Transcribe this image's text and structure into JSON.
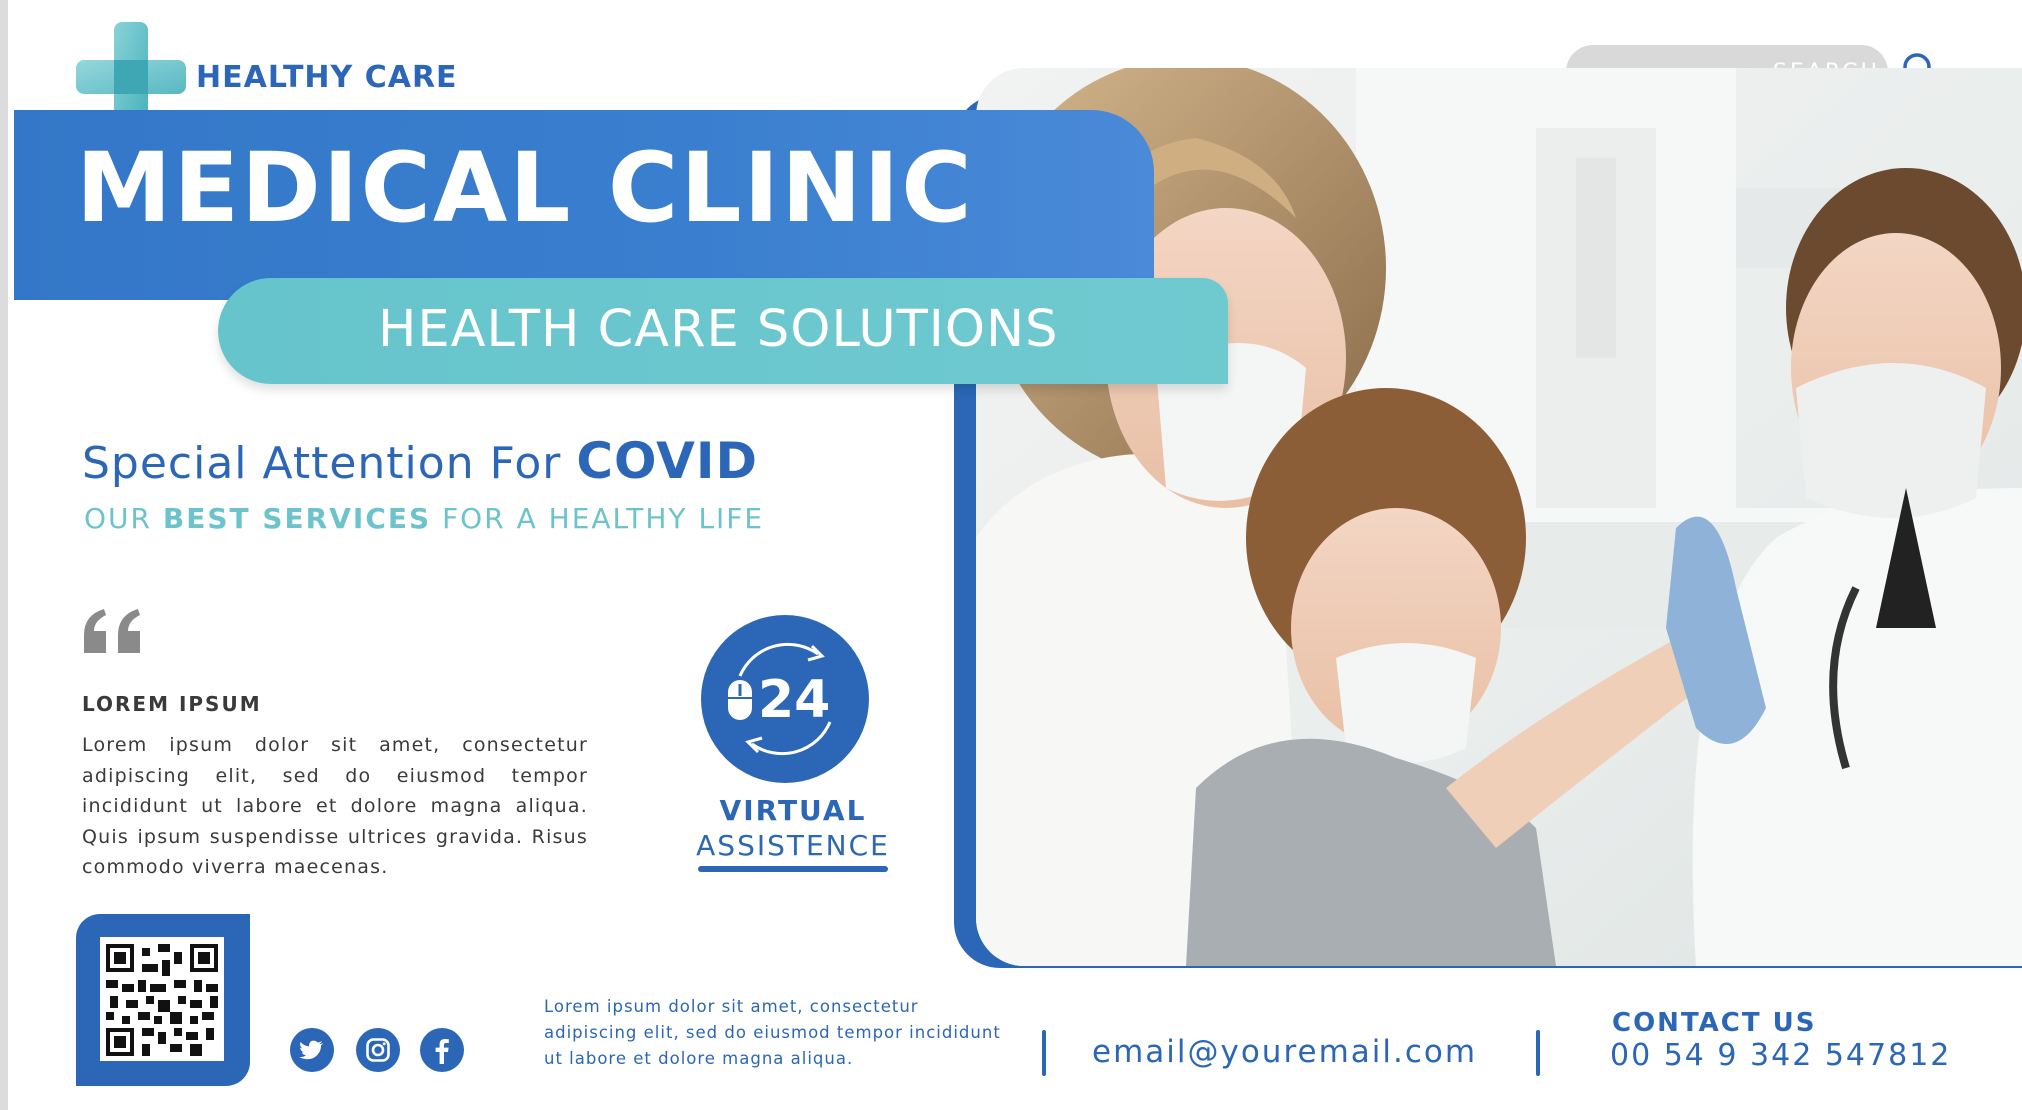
{
  "brand": {
    "name": "HEALTHY CARE",
    "logo_icon": "medical-cross-icon"
  },
  "search": {
    "label": "SEARCH",
    "icon": "search-icon"
  },
  "hero": {
    "title": "MEDICAL CLINIC",
    "subtitle": "HEALTH CARE SOLUTIONS"
  },
  "headline": {
    "prefix": "Special Attention For",
    "emphasis": "COVID",
    "services_prefix": "OUR",
    "services_emphasis": "BEST SERVICES",
    "services_suffix": "FOR A HEALTHY LIFE"
  },
  "quote": {
    "icon": "quote-icon",
    "heading": "LOREM IPSUM",
    "body": "Lorem ipsum dolor sit amet, consectetur adipiscing elit, sed do eiusmod tempor incididunt ut labore et dolore magna aliqua. Quis ipsum suspendisse ultrices gravida. Risus commodo viverra maecenas."
  },
  "badge": {
    "number": "24",
    "line1": "VIRTUAL",
    "line2": "ASSISTENCE",
    "icon": "mouse-cycle-icon"
  },
  "footer": {
    "qr_icon": "qr-code-icon",
    "social": [
      "twitter-icon",
      "instagram-icon",
      "facebook-icon"
    ],
    "lorem": "Lorem ipsum dolor sit amet, consectetur adipiscing elit, sed do eiusmod tempor incididunt ut labore et dolore magna aliqua.",
    "email": "email@youremail.com",
    "contact_heading": "CONTACT US",
    "phone": "00 54 9 342 547812"
  },
  "colors": {
    "primary_blue": "#2b67b6",
    "banner_blue": "#3a7fcf",
    "teal": "#6cc3cb",
    "search_gray": "#d9d9d9"
  }
}
